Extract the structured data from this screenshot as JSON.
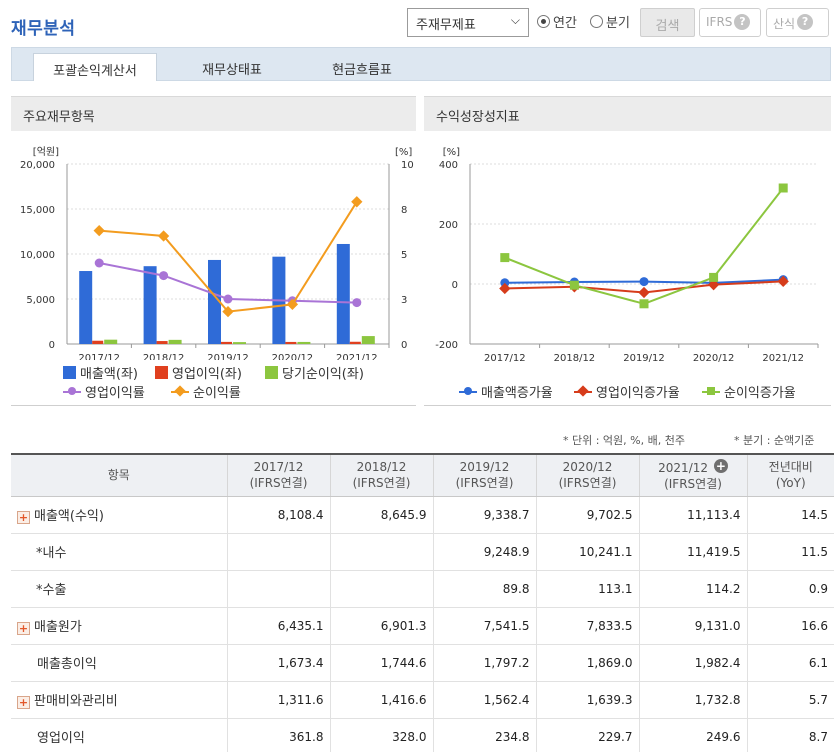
{
  "header": {
    "title": "재무분석",
    "report_select": "주재무제표",
    "period_annual": "연간",
    "period_quarter": "분기",
    "search_label": "검색",
    "ifrs_label": "IFRS",
    "formula_label": "산식",
    "help_glyph": "?"
  },
  "tabs": [
    "포괄손익계산서",
    "재무상태표",
    "현금흐름표"
  ],
  "panels": {
    "left_title": "주요재무항목",
    "right_title": "수익성장성지표"
  },
  "colors": {
    "sales": "#2f6bd7",
    "op_income": "#e0401f",
    "net_income": "#8cc63f",
    "op_margin": "#a974d6",
    "net_margin": "#f39c1f",
    "sales_growth": "#2f6bd7",
    "op_growth": "#d63c1b",
    "net_growth": "#8cc63f"
  },
  "chart_data": [
    {
      "type": "bar",
      "categories": [
        "2017/12",
        "2018/12",
        "2019/12",
        "2020/12",
        "2021/12"
      ],
      "left_unit": "[억원]",
      "right_unit": "[%]",
      "left_ticks": [
        "0",
        "5,000",
        "10,000",
        "15,000",
        "20,000"
      ],
      "right_ticks": [
        "0",
        "3",
        "5",
        "8",
        "10"
      ],
      "ylim": [
        0,
        20000
      ],
      "y2lim": [
        0,
        10
      ],
      "series": [
        {
          "name": "매출액(좌)",
          "axis": "left",
          "kind": "bar",
          "values": [
            8108.4,
            8645.9,
            9338.7,
            9702.5,
            11113.4
          ]
        },
        {
          "name": "영업이익(좌)",
          "axis": "left",
          "kind": "bar",
          "values": [
            361.8,
            328.0,
            234.8,
            229.7,
            249.6
          ]
        },
        {
          "name": "당기순이익(좌)",
          "axis": "left",
          "kind": "bar",
          "values": [
            480,
            460,
            210,
            230,
            880
          ]
        },
        {
          "name": "영업이익률",
          "axis": "right",
          "kind": "line",
          "values": [
            4.5,
            3.8,
            2.5,
            2.4,
            2.3
          ]
        },
        {
          "name": "순이익률",
          "axis": "right",
          "kind": "line",
          "values": [
            6.3,
            6.0,
            1.8,
            2.2,
            7.9
          ]
        }
      ]
    },
    {
      "type": "line",
      "categories": [
        "2017/12",
        "2018/12",
        "2019/12",
        "2020/12",
        "2021/12"
      ],
      "left_unit": "[%]",
      "left_ticks": [
        "-200",
        "0",
        "200",
        "400"
      ],
      "ylim": [
        -200,
        400
      ],
      "series": [
        {
          "name": "매출액증가율",
          "values": [
            4.0,
            6.6,
            8.0,
            3.9,
            14.5
          ]
        },
        {
          "name": "영업이익증가율",
          "values": [
            -15,
            -9.3,
            -28.4,
            -2.2,
            8.7
          ]
        },
        {
          "name": "순이익증가율",
          "values": [
            88,
            -4,
            -66,
            22,
            320
          ]
        }
      ]
    }
  ],
  "table": {
    "unit_note": "* 단위 : 억원, %, 배, 천주",
    "quarter_note": "* 분기 : 순액기준",
    "headers": [
      {
        "l1": "항목",
        "l2": ""
      },
      {
        "l1": "2017/12",
        "l2": "(IFRS연결)"
      },
      {
        "l1": "2018/12",
        "l2": "(IFRS연결)"
      },
      {
        "l1": "2019/12",
        "l2": "(IFRS연결)"
      },
      {
        "l1": "2020/12",
        "l2": "(IFRS연결)"
      },
      {
        "l1": "2021/12",
        "l2": "(IFRS연결)"
      },
      {
        "l1": "전년대비",
        "l2": "(YoY)"
      }
    ],
    "expand_glyph": "+",
    "rows": [
      {
        "label": "매출액(수익)",
        "expand": true,
        "style": "",
        "cells": [
          "8,108.4",
          "8,645.9",
          "9,338.7",
          "9,702.5",
          "11,113.4",
          "14.5"
        ]
      },
      {
        "label": "*내수",
        "expand": false,
        "style": "sub",
        "cells": [
          "",
          "",
          "9,248.9",
          "10,241.1",
          "11,419.5",
          "11.5"
        ]
      },
      {
        "label": "*수출",
        "expand": false,
        "style": "sub",
        "cells": [
          "",
          "",
          "89.8",
          "113.1",
          "114.2",
          "0.9"
        ]
      },
      {
        "label": "매출원가",
        "expand": true,
        "style": "",
        "cells": [
          "6,435.1",
          "6,901.3",
          "7,541.5",
          "7,833.5",
          "9,131.0",
          "16.6"
        ]
      },
      {
        "label": "매출총이익",
        "expand": false,
        "style": "indent",
        "cells": [
          "1,673.4",
          "1,744.6",
          "1,797.2",
          "1,869.0",
          "1,982.4",
          "6.1"
        ]
      },
      {
        "label": "판매비와관리비",
        "expand": true,
        "style": "",
        "cells": [
          "1,311.6",
          "1,416.6",
          "1,562.4",
          "1,639.3",
          "1,732.8",
          "5.7"
        ]
      },
      {
        "label": "영업이익",
        "expand": false,
        "style": "indent",
        "cells": [
          "361.8",
          "328.0",
          "234.8",
          "229.7",
          "249.6",
          "8.7"
        ]
      }
    ]
  }
}
